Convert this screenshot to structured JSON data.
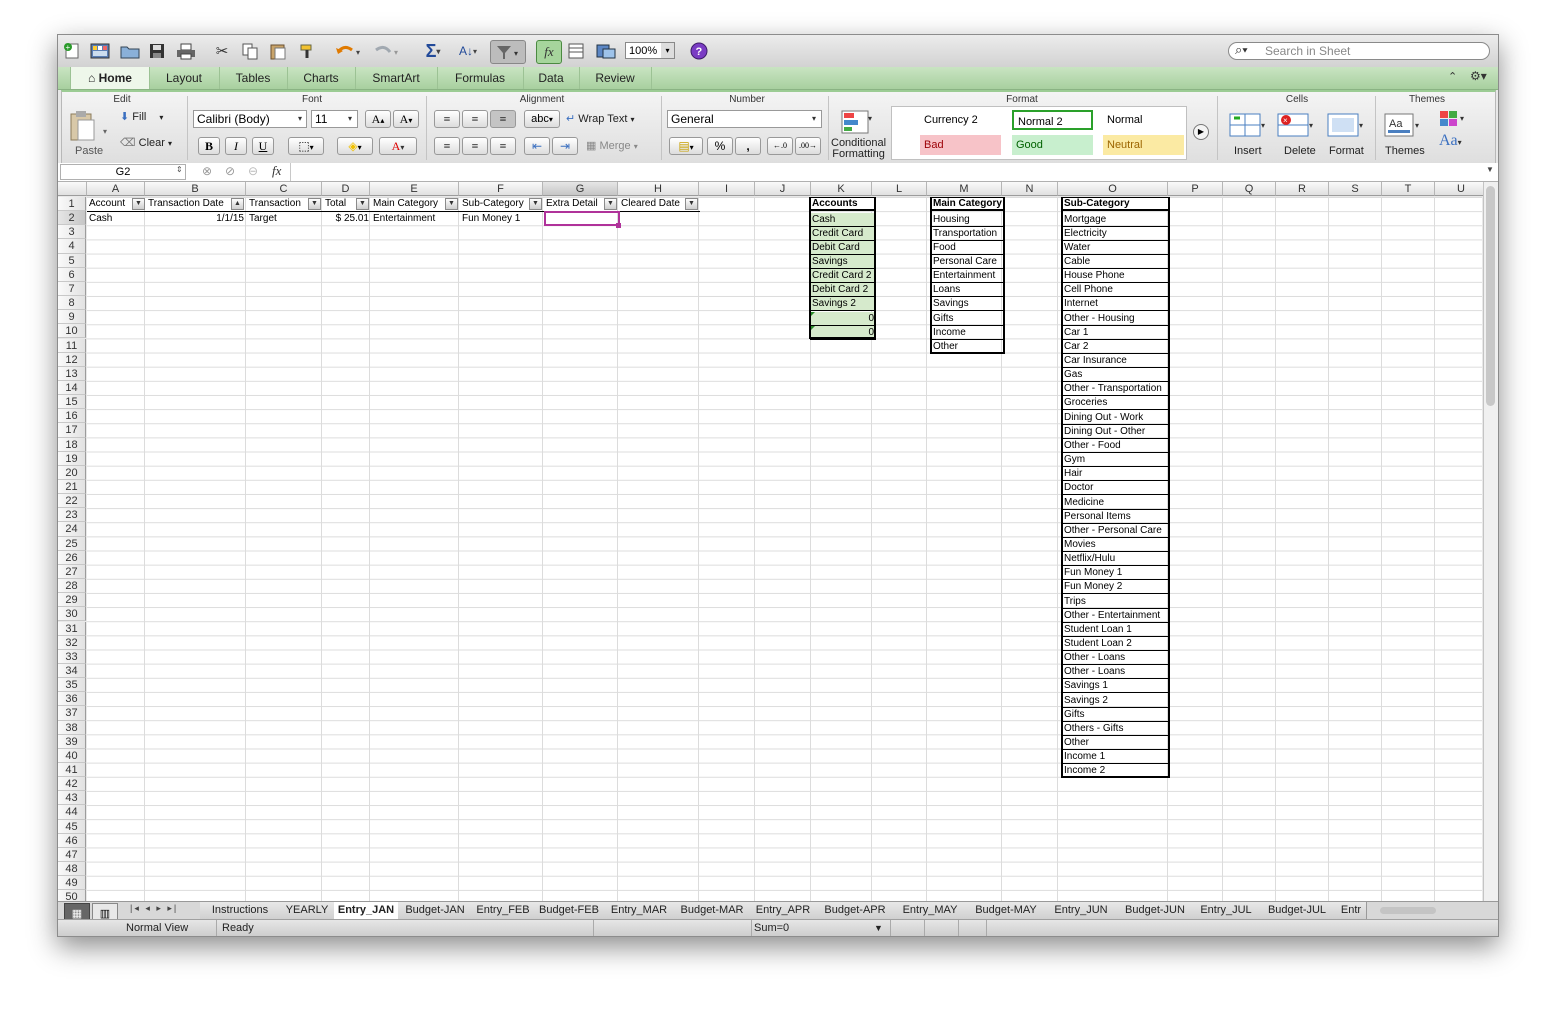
{
  "toolbar": {
    "zoom": "100%",
    "search_placeholder": "Search in Sheet"
  },
  "ribbon_tabs": [
    "Home",
    "Layout",
    "Tables",
    "Charts",
    "SmartArt",
    "Formulas",
    "Data",
    "Review"
  ],
  "groups": {
    "edit": "Edit",
    "font": "Font",
    "alignment": "Alignment",
    "number": "Number",
    "format": "Format",
    "cells": "Cells",
    "themes": "Themes"
  },
  "edit": {
    "paste": "Paste",
    "fill": "Fill",
    "clear": "Clear"
  },
  "font": {
    "name": "Calibri (Body)",
    "size": "11",
    "bold": "B",
    "italic": "I",
    "underline": "U"
  },
  "alignment": {
    "abc": "abc",
    "wrap_text": "Wrap Text",
    "merge": "Merge"
  },
  "number": {
    "format": "General",
    "percent": "%",
    "comma": ","
  },
  "format": {
    "conditional_line1": "Conditional",
    "conditional_line2": "Formatting",
    "styles": [
      "Currency 2",
      "Normal 2",
      "Normal",
      "Bad",
      "Good",
      "Neutral"
    ]
  },
  "cells": {
    "insert": "Insert",
    "delete": "Delete",
    "format": "Format"
  },
  "themes": {
    "themes": "Themes",
    "fonts_glyph": "Aa"
  },
  "formula_bar": {
    "name_box": "G2",
    "fx": "fx",
    "content": ""
  },
  "columns": [
    "A",
    "B",
    "C",
    "D",
    "E",
    "F",
    "G",
    "H",
    "I",
    "J",
    "K",
    "L",
    "M",
    "N",
    "O",
    "P",
    "Q",
    "R",
    "S",
    "T",
    "U"
  ],
  "row_numbers": [
    "1",
    "2",
    "3",
    "4",
    "5",
    "6",
    "7",
    "8",
    "9",
    "10",
    "11",
    "12",
    "13",
    "14",
    "15",
    "16",
    "17",
    "18",
    "19",
    "20",
    "21",
    "22",
    "23",
    "24",
    "25",
    "26",
    "27",
    "28",
    "29",
    "30",
    "31",
    "32",
    "33",
    "34",
    "35",
    "36",
    "37",
    "38",
    "39",
    "40",
    "41",
    "42",
    "43",
    "44",
    "45",
    "46",
    "47",
    "48",
    "49",
    "50"
  ],
  "table": {
    "headers": [
      "Account",
      "Transaction Date",
      "Transaction",
      "Total",
      "Main Category",
      "Sub-Category",
      "Extra Detail",
      "Cleared Date"
    ],
    "row2": {
      "account": "Cash",
      "date": "1/1/15",
      "transaction": "Target",
      "total": "$ 25.01",
      "main_category": "Entertainment",
      "sub_category": "Fun Money 1",
      "extra_detail": "",
      "cleared_date": ""
    }
  },
  "accounts_list": {
    "header": "Accounts",
    "items": [
      "Cash",
      "Credit Card",
      "Debit Card",
      "Savings",
      "Credit Card 2",
      "Debit Card 2",
      "Savings 2",
      "0",
      "0"
    ]
  },
  "main_category_list": {
    "header": "Main Category",
    "items": [
      "Housing",
      "Transportation",
      "Food",
      "Personal Care",
      "Entertainment",
      "Loans",
      "Savings",
      "Gifts",
      "Income",
      "Other"
    ]
  },
  "sub_category_list": {
    "header": "Sub-Category",
    "items": [
      "Mortgage",
      "Electricity",
      "Water",
      "Cable",
      "House Phone",
      "Cell Phone",
      "Internet",
      "Other - Housing",
      "Car 1",
      "Car 2",
      "Car Insurance",
      "Gas",
      "Other - Transportation",
      "Groceries",
      "Dining Out - Work",
      "Dining Out - Other",
      "Other - Food",
      "Gym",
      "Hair",
      "Doctor",
      "Medicine",
      "Personal Items",
      "Other - Personal Care",
      "Movies",
      "Netflix/Hulu",
      "Fun Money 1",
      "Fun Money 2",
      "Trips",
      "Other - Entertainment",
      "Student Loan 1",
      "Student Loan 2",
      "Other - Loans",
      "Other - Loans",
      "Savings 1",
      "Savings 2",
      "Gifts",
      "Others - Gifts",
      "Other",
      "Income 1",
      "Income 2"
    ]
  },
  "sheet_tabs": [
    "Instructions",
    "YEARLY",
    "Entry_JAN",
    "Budget-JAN",
    "Entry_FEB",
    "Budget-FEB",
    "Entry_MAR",
    "Budget-MAR",
    "Entry_APR",
    "Budget-APR",
    "Entry_MAY",
    "Budget-MAY",
    "Entry_JUN",
    "Budget-JUN",
    "Entry_JUL",
    "Budget-JUL",
    "Entr"
  ],
  "active_sheet": "Entry_JAN",
  "status": {
    "view": "Normal View",
    "state": "Ready",
    "sum": "Sum=0"
  },
  "colors": {
    "ribbon_green": "#a8d09f",
    "list_green": "#d6eacc",
    "bad": "#f7c3c8",
    "good": "#c8efce",
    "neutral": "#fbeaa3",
    "selection": "#b0329a"
  }
}
